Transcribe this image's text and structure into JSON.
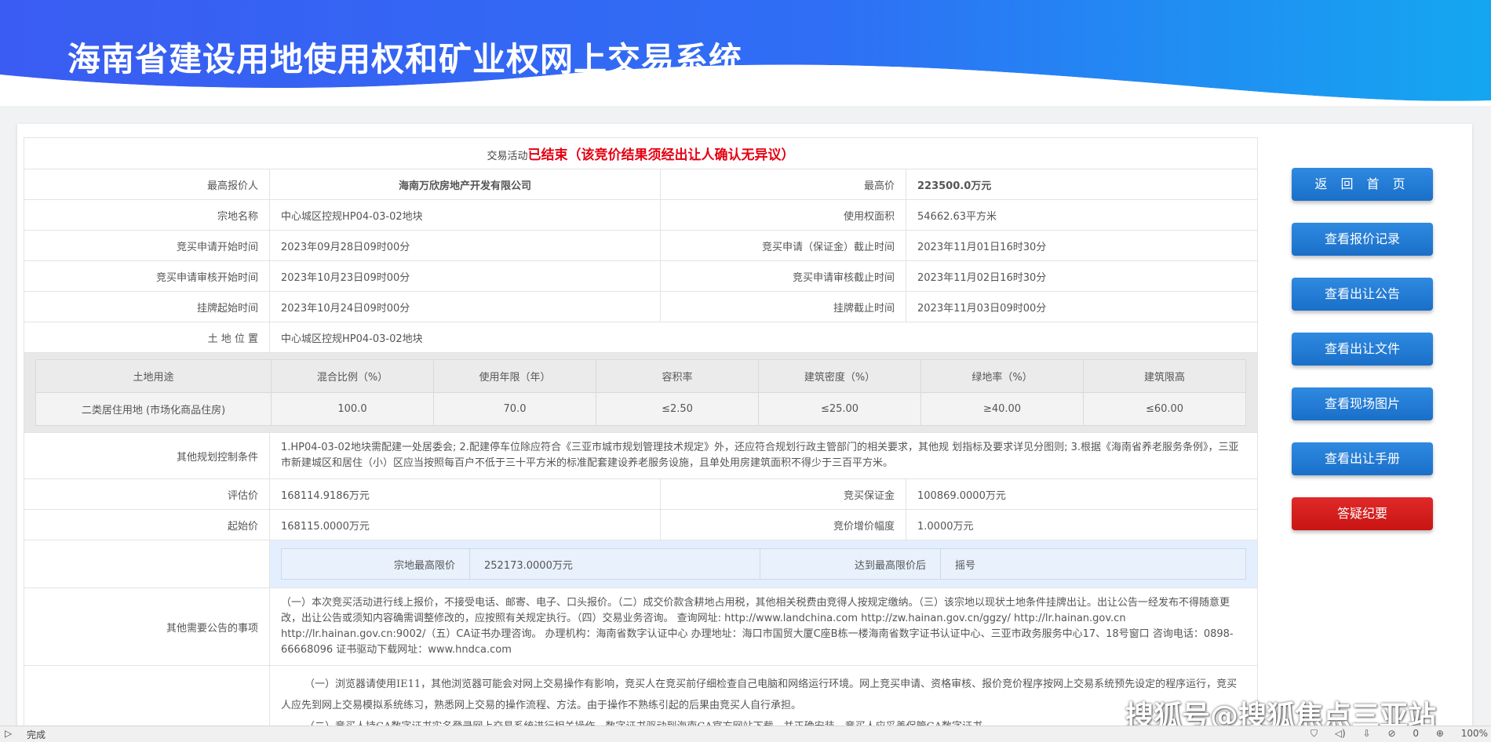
{
  "header": {
    "title": "海南省建设用地使用权和矿业权网上交易系统"
  },
  "status": {
    "prefix": "交易活动",
    "text": "已结束（该竞价结果须经出让人确认无异议）"
  },
  "rows": {
    "top_bidder_label": "最高报价人",
    "top_bidder": "海南万欣房地产开发有限公司",
    "top_price_label": "最高价",
    "top_price": "223500.0万元",
    "parcel_name_label": "宗地名称",
    "parcel_name": "中心城区控规HP04-03-02地块",
    "area_label": "使用权面积",
    "area": "54662.63平方米",
    "apply_start_label": "竞买申请开始时间",
    "apply_start": "2023年09月28日09时00分",
    "apply_end_label": "竞买申请（保证金）截止时间",
    "apply_end": "2023年11月01日16时30分",
    "review_start_label": "竞买申请审核开始时间",
    "review_start": "2023年10月23日09时00分",
    "review_end_label": "竞买申请审核截止时间",
    "review_end": "2023年11月02日16时30分",
    "listing_start_label": "挂牌起始时间",
    "listing_start": "2023年10月24日09时00分",
    "listing_end_label": "挂牌截止时间",
    "listing_end": "2023年11月03日09时00分",
    "location_label": "土 地 位 置",
    "location": "中心城区控规HP04-03-02地块"
  },
  "land_use_table": {
    "headers": [
      "土地用途",
      "混合比例（%）",
      "使用年限（年）",
      "容积率",
      "建筑密度（%）",
      "绿地率（%）",
      "建筑限高"
    ],
    "values": [
      "二类居住用地 (市场化商品住房)",
      "100.0",
      "70.0",
      "≤2.50",
      "≤25.00",
      "≥40.00",
      "≤60.00"
    ]
  },
  "planning": {
    "label": "其他规划控制条件",
    "text": "1.HP04-03-02地块需配建一处居委会; 2.配建停车位除应符合《三亚市城市规划管理技术规定》外，还应符合规划行政主管部门的相关要求，其他规 划指标及要求详见分图则; 3.根据《海南省养老服务条例》，三亚市新建城区和居住（小）区应当按照每百户不低于三十平方米的标准配套建设养老服务设施，且单处用房建筑面积不得少于三百平方米。"
  },
  "prices": {
    "assess_label": "评估价",
    "assess": "168114.9186万元",
    "deposit_label": "竞买保证金",
    "deposit": "100869.0000万元",
    "start_label": "起始价",
    "start": "168115.0000万元",
    "increment_label": "竞价增价幅度",
    "increment": "1.0000万元"
  },
  "limit": {
    "max_label": "宗地最高限价",
    "max": "252173.0000万元",
    "after_label": "达到最高限价后",
    "after": "摇号"
  },
  "other": {
    "label": "其他需要公告的事项",
    "text": "（一）本次竞买活动进行线上报价，不接受电话、邮寄、电子、口头报价。（二）成交价款含耕地占用税，其他相关税费由竞得人按规定缴纳。（三）该宗地以现状土地条件挂牌出让。出让公告一经发布不得随意更改，出让公告或须知内容确需调整修改的，应按照有关规定执行。（四）交易业务咨询。 查询网址: http://www.landchina.com http://zw.hainan.gov.cn/ggzy/ http://lr.hainan.gov.cn http://lr.hainan.gov.cn:9002/（五）CA证书办理咨询。 办理机构：海南省数字认证中心 办理地址：海口市国贸大厦C座B栋一楼海南省数字证书认证中心、三亚市政务服务中心17、18号窗口 咨询电话：0898-66668096 证书驱动下载网址：www.hndca.com"
  },
  "notice": {
    "p1": "（一）浏览器请使用IE11，其他浏览器可能会对网上交易操作有影响，竞买人在竞买前仔细检查自己电脑和网络运行环境。网上竞买申请、资格审核、报价竞价程序按网上交易系统预先设定的程序运行，竞买人应先到网上交易模拟系统练习，熟悉网上交易的操作流程、方法。由于操作不熟练引起的后果由竞买人自行承担。",
    "p2": "（二）竞买人持CA数字证书实名登录网上交易系统进行相关操作，数字证书驱动到海南CA官方网站下载，并正确安装，竞买人应妥善保管CA数字证书，"
  },
  "buttons": {
    "home": "返 回 首 页",
    "bids": "查看报价记录",
    "announce": "查看出让公告",
    "docs": "查看出让文件",
    "photos": "查看现场图片",
    "manual": "查看出让手册",
    "faq": "答疑纪要"
  },
  "watermark": "搜狐号@搜狐焦点三亚站",
  "statusbar": {
    "text": "完成",
    "zoom": "100%",
    "count": "0"
  },
  "colors": {
    "accent_blue": "#1a6fc9",
    "status_red": "#e60012"
  }
}
